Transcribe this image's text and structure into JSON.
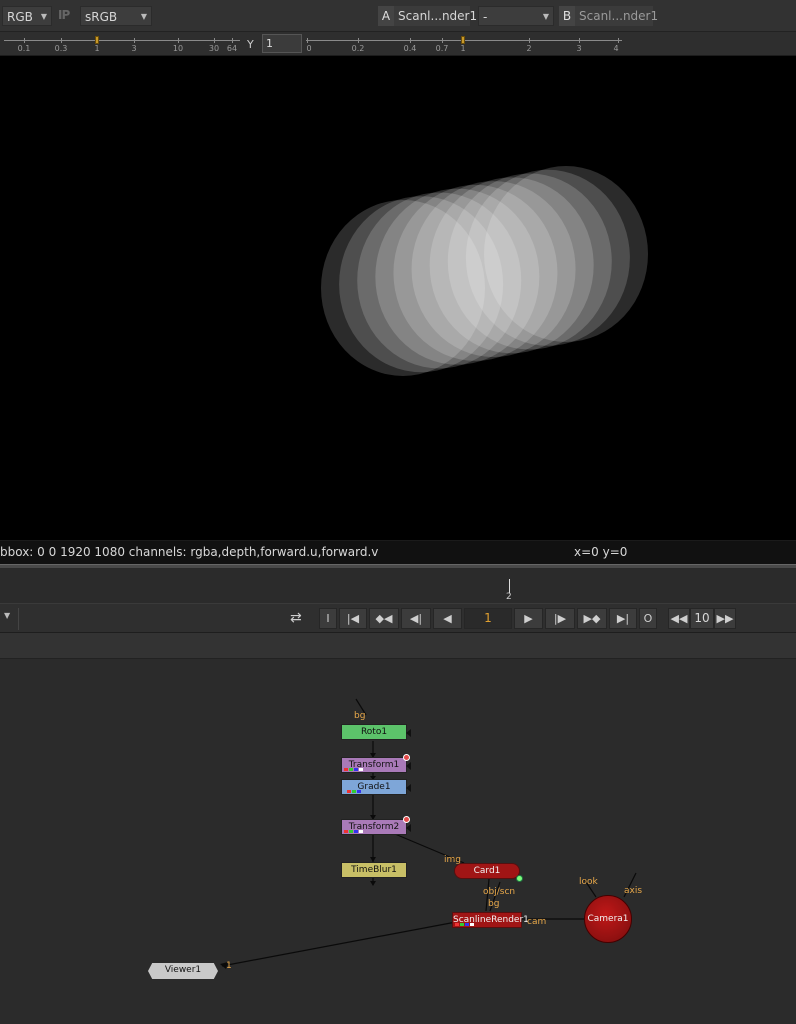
{
  "toolbar": {
    "channels": "RGB",
    "ip_label": "IP",
    "lut": "sRGB",
    "a_letter": "A",
    "a_input": "Scanl...nder1",
    "operation": "-",
    "b_letter": "B",
    "b_input": "Scanl...nder1"
  },
  "gain_slider": {
    "labels": [
      "0.1",
      "0.3",
      "1",
      "3",
      "10",
      "30",
      "64"
    ]
  },
  "gamma": {
    "label": "Y",
    "value": "1",
    "labels": [
      "0",
      "0.2",
      "0.4",
      "0.7",
      "1",
      "2",
      "3",
      "4"
    ]
  },
  "viewer": {
    "shape": "motion-blurred-ellipse",
    "ellipse_count": 10
  },
  "info": {
    "bbox": "bbox: 0 0 1920 1080 channels: rgba,depth,forward.u,forward.v",
    "coords": "x=0 y=0"
  },
  "timeline": {
    "marker_label": "2"
  },
  "transport": {
    "in_label": "I",
    "frame": "1",
    "out_label": "O",
    "increment": "10",
    "icons": [
      "loop-icon",
      "first-frame-icon",
      "prev-keyframe-icon",
      "prev-frame-icon",
      "play-backward-icon",
      "play-forward-icon",
      "next-frame-icon",
      "next-keyframe-icon",
      "last-frame-icon",
      "rewind-increment-icon",
      "forward-increment-icon"
    ]
  },
  "nodes": {
    "roto": "Roto1",
    "transform1": "Transform1",
    "grade": "Grade1",
    "transform2": "Transform2",
    "timeblur": "TimeBlur1",
    "card": "Card1",
    "scanline": "ScanlineRender1",
    "camera": "Camera1",
    "viewer": "Viewer1"
  },
  "pins": {
    "bg_top": "bg",
    "img": "img",
    "obj_scn": "obj/scn",
    "bg_scan": "bg",
    "cam": "cam",
    "look": "look",
    "axis": "axis",
    "viewer_input": "1"
  },
  "colors": {
    "roto": "#5cc36a",
    "transform": "#a97ab8",
    "grade": "#7ea6d8",
    "timeblur": "#c8bf66",
    "render": "#a01515",
    "frame_accent": "#e0a030",
    "pin_label": "#e8a84a"
  }
}
